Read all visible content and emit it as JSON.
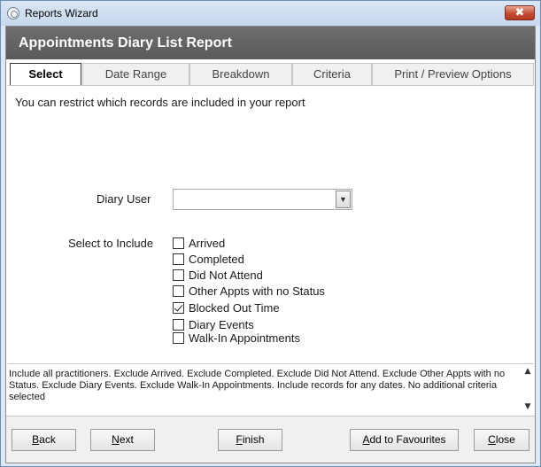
{
  "window": {
    "title": "Reports Wizard",
    "close_glyph": "✖"
  },
  "header": {
    "title": "Appointments Diary List Report"
  },
  "tabs": [
    {
      "label": "Select"
    },
    {
      "label": "Date Range"
    },
    {
      "label": "Breakdown"
    },
    {
      "label": "Criteria"
    },
    {
      "label": "Print / Preview Options"
    }
  ],
  "select_panel": {
    "info": "You can restrict which records are included in your report",
    "diary_user_label": "Diary User",
    "diary_user_value": "",
    "include_label": "Select to Include",
    "options": [
      {
        "label": "Arrived",
        "checked": false
      },
      {
        "label": "Completed",
        "checked": false
      },
      {
        "label": "Did Not Attend",
        "checked": false
      },
      {
        "label": "Other Appts with no Status",
        "checked": false
      },
      {
        "label": "Blocked Out Time",
        "checked": true
      },
      {
        "label": "Diary Events",
        "checked": false
      },
      {
        "label": "Walk-In Appointments",
        "checked": false
      }
    ]
  },
  "summary": {
    "text": "Include all practitioners. Exclude Arrived. Exclude Completed. Exclude Did Not Attend. Exclude Other Appts with no Status. Exclude Diary Events. Exclude Walk-In Appointments. Include records for any dates. No additional criteria selected"
  },
  "buttons": {
    "back": {
      "mnemonic": "B",
      "rest": "ack"
    },
    "next": {
      "mnemonic": "N",
      "rest": "ext"
    },
    "finish": {
      "mnemonic": "F",
      "rest": "inish"
    },
    "favourites": {
      "mnemonic": "A",
      "rest": "dd to Favourites"
    },
    "close": {
      "mnemonic": "C",
      "rest": "lose"
    }
  },
  "icons": {
    "app": "app-logo-icon",
    "dropdown": "chevron-down-icon",
    "scroll_up": "scroll-up-icon",
    "scroll_down": "scroll-down-icon"
  }
}
